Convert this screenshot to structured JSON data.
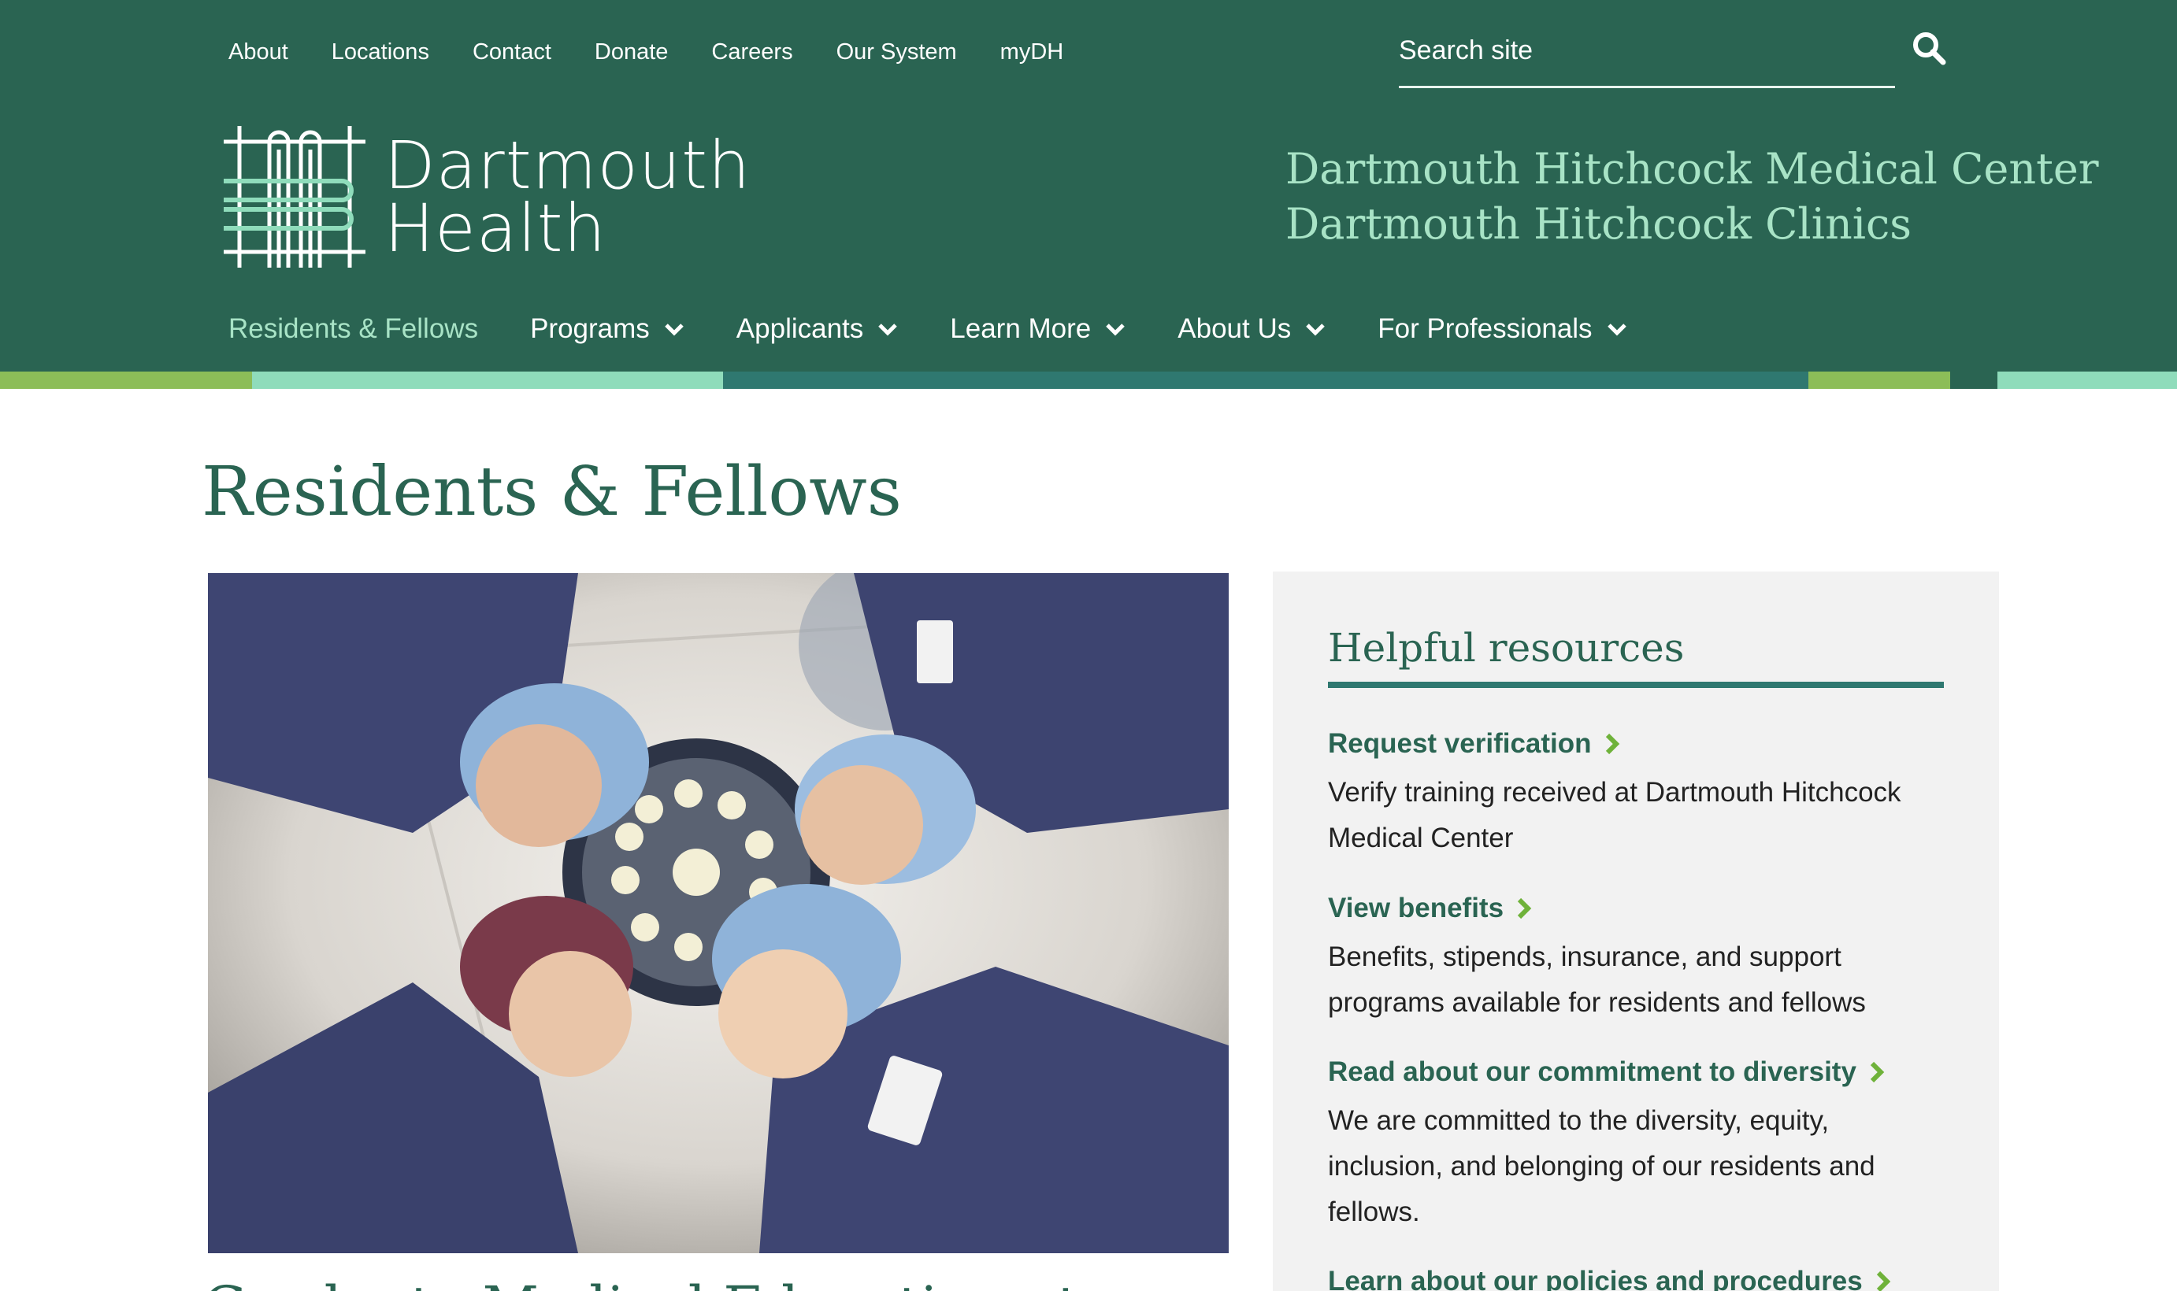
{
  "utility_nav": [
    "About",
    "Locations",
    "Contact",
    "Donate",
    "Careers",
    "Our System",
    "myDH"
  ],
  "search": {
    "placeholder": "Search site"
  },
  "logo": {
    "line1": "Dartmouth",
    "line2": "Health"
  },
  "affiliates": [
    "Dartmouth Hitchcock Medical Center",
    "Dartmouth Hitchcock Clinics"
  ],
  "main_nav": [
    {
      "label": "Residents & Fellows",
      "dropdown": false,
      "active": true
    },
    {
      "label": "Programs",
      "dropdown": true
    },
    {
      "label": "Applicants",
      "dropdown": true
    },
    {
      "label": "Learn More",
      "dropdown": true
    },
    {
      "label": "About Us",
      "dropdown": true
    },
    {
      "label": "For Professionals",
      "dropdown": true
    }
  ],
  "colors": {
    "header_bg": "#2a6452",
    "accent_light": "#a8e3c6",
    "bar_green": "#8cbd58",
    "bar_mint": "#8fdcbb",
    "bar_teal": "#2f7870"
  },
  "page": {
    "title": "Residents & Fellows",
    "next_heading": "Graduate Medical Education at"
  },
  "hero_image": {
    "icon": "photo-surgeons-icon"
  },
  "sidebar": {
    "title": "Helpful resources",
    "resources": [
      {
        "link": "Request verification",
        "desc": "Verify training received at Dartmouth Hitchcock Medical Center"
      },
      {
        "link": "View benefits",
        "desc": "Benefits, stipends, insurance, and support programs available for residents and fellows"
      },
      {
        "link": "Read about our commitment to diversity",
        "desc": "We are committed to the diversity, equity, inclusion, and belonging of our residents and fellows."
      },
      {
        "link": "Learn about our policies and procedures",
        "desc": ""
      }
    ]
  }
}
